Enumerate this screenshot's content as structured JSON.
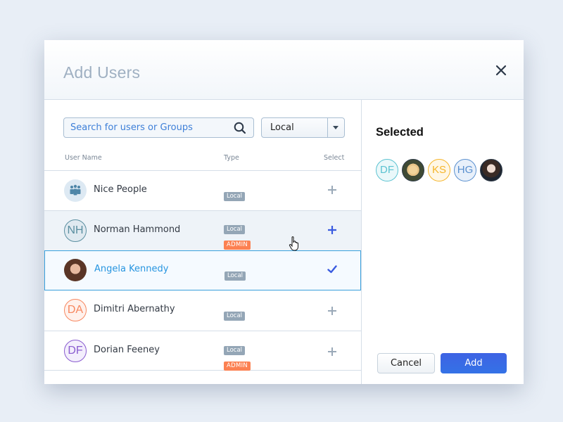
{
  "modal": {
    "title": "Add Users",
    "close_icon": "close-icon"
  },
  "search": {
    "placeholder": "Search for users or Groups",
    "value": "",
    "icon": "search-icon"
  },
  "source_select": {
    "selected": "Local",
    "icon": "chevron-down-icon"
  },
  "table": {
    "columns": [
      "User Name",
      "Type",
      "Select"
    ],
    "rows": [
      {
        "name": "Nice People",
        "avatar_type": "group",
        "initials": "",
        "badges": [
          "Local"
        ],
        "action": "add",
        "state": "normal"
      },
      {
        "name": "Norman Hammond",
        "avatar_type": "initials",
        "initials": "NH",
        "badges": [
          "Local",
          "ADMIN"
        ],
        "action": "add",
        "state": "hover"
      },
      {
        "name": "Angela Kennedy",
        "avatar_type": "photo",
        "initials": "",
        "badges": [
          "Local"
        ],
        "action": "selected",
        "state": "selected"
      },
      {
        "name": "Dimitri Abernathy",
        "avatar_type": "initials",
        "initials": "DA",
        "badges": [
          "Local"
        ],
        "action": "add",
        "state": "normal"
      },
      {
        "name": "Dorian Feeney",
        "avatar_type": "initials",
        "initials": "DF",
        "badges": [
          "Local",
          "ADMIN"
        ],
        "action": "add",
        "state": "normal"
      }
    ]
  },
  "selected_panel": {
    "title": "Selected",
    "chips": [
      {
        "type": "initials",
        "initials": "DF",
        "color": "#5cc3d1"
      },
      {
        "type": "photo",
        "initials": ""
      },
      {
        "type": "initials",
        "initials": "KS",
        "color": "#f5b52a"
      },
      {
        "type": "initials",
        "initials": "HG",
        "color": "#5a90cf"
      },
      {
        "type": "photo",
        "initials": ""
      }
    ]
  },
  "buttons": {
    "cancel": "Cancel",
    "add": "Add"
  },
  "colors": {
    "accent": "#3a68e4",
    "selected_border": "#3aa0dc",
    "badge_local": "#94a6b6",
    "badge_admin": "#fc8152",
    "avatar_NH": "#5a8ea0",
    "avatar_DA": "#f7875f",
    "avatar_DF": "#8a5cd0"
  }
}
